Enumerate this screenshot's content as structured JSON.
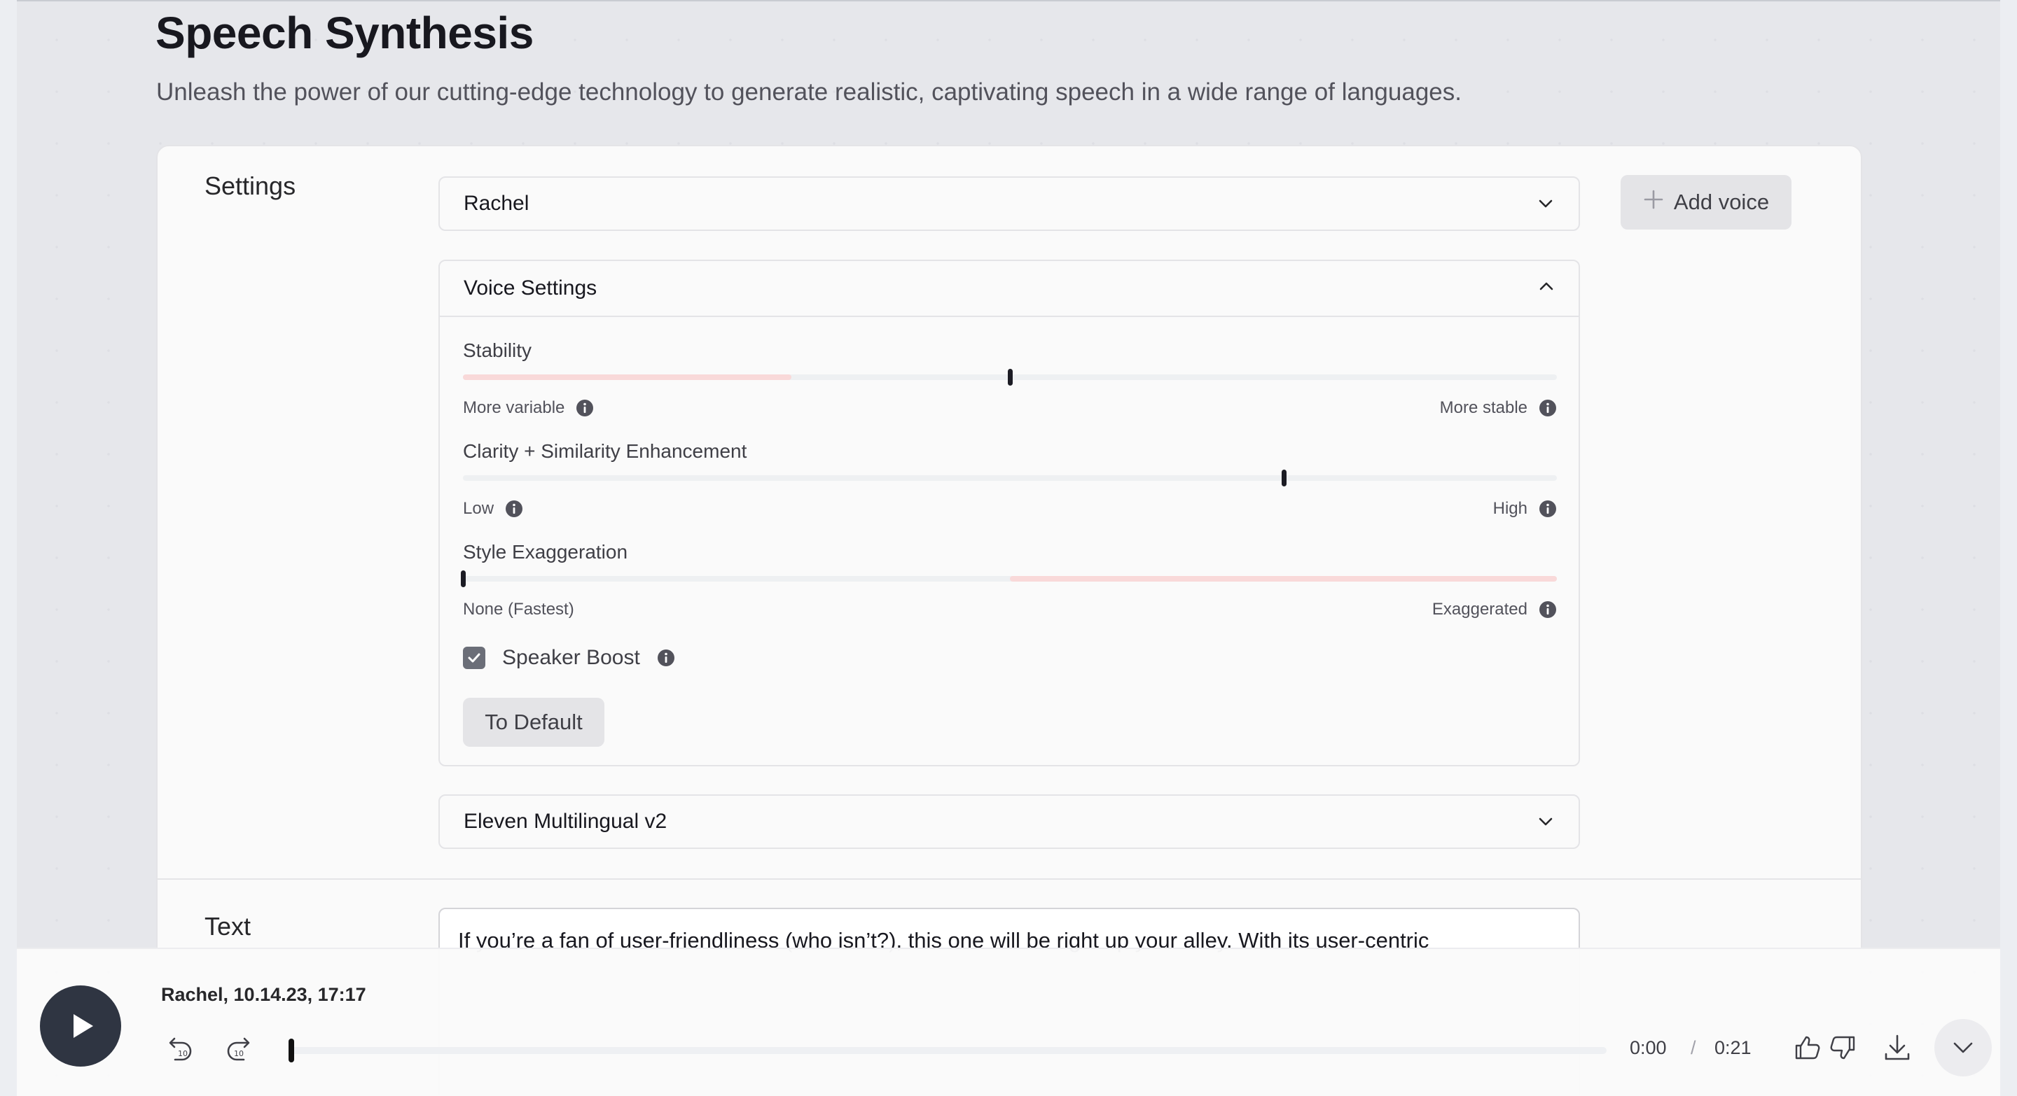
{
  "header": {
    "title": "Speech Synthesis",
    "subtitle": "Unleash the power of our cutting-edge technology to generate realistic, captivating speech in a wide range of languages."
  },
  "settings": {
    "section_label": "Settings",
    "voice_select": {
      "value": "Rachel"
    },
    "add_voice_label": "Add voice",
    "voice_settings": {
      "title": "Voice Settings",
      "stability": {
        "label": "Stability",
        "min_label": "More variable",
        "max_label": "More stable",
        "value": 0.5,
        "recommended_range": [
          0.0,
          0.3
        ]
      },
      "clarity": {
        "label": "Clarity + Similarity Enhancement",
        "min_label": "Low",
        "max_label": "High",
        "value": 0.75
      },
      "style": {
        "label": "Style Exaggeration",
        "min_label": "None (Fastest)",
        "max_label": "Exaggerated",
        "value": 0.0,
        "warning_range": [
          0.5,
          1.0
        ]
      },
      "speaker_boost": {
        "label": "Speaker Boost",
        "checked": true
      },
      "reset_label": "To Default"
    },
    "model_select": {
      "value": "Eleven Multilingual v2"
    }
  },
  "text_section": {
    "section_label": "Text",
    "content": "If you’re a fan of user-friendliness (who isn’t?), this one will be right up your alley. With its user-centric"
  },
  "player": {
    "now_playing": "Rachel, 10.14.23, 17:17",
    "current_time": "0:00",
    "separator": "/",
    "duration": "0:21",
    "progress": 0.0
  },
  "colors": {
    "accent_dark": "#2f3542",
    "range_highlight": "#f9d9d9"
  }
}
